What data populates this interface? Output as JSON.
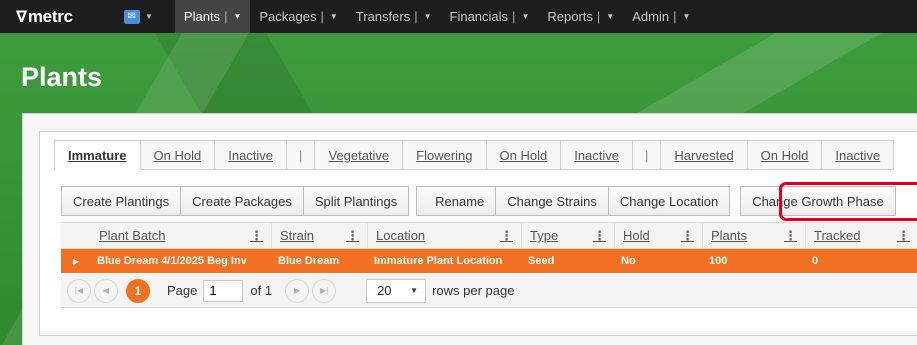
{
  "brand": {
    "logo": "∇",
    "name": "metrc"
  },
  "nav": {
    "mail_icon": "envelope-icon",
    "items": [
      {
        "label": "Plants",
        "active": true
      },
      {
        "label": "Packages",
        "active": false
      },
      {
        "label": "Transfers",
        "active": false
      },
      {
        "label": "Financials",
        "active": false
      },
      {
        "label": "Reports",
        "active": false
      },
      {
        "label": "Admin",
        "active": false
      }
    ],
    "separator": "|",
    "dropdown_glyph": "▼"
  },
  "page": {
    "title": "Plants"
  },
  "tabs": [
    {
      "label": "Immature",
      "active": true
    },
    {
      "label": "On Hold"
    },
    {
      "label": "Inactive"
    },
    {
      "label": "|"
    },
    {
      "label": "Vegetative"
    },
    {
      "label": "Flowering"
    },
    {
      "label": "On Hold"
    },
    {
      "label": "Inactive"
    },
    {
      "label": "|"
    },
    {
      "label": "Harvested"
    },
    {
      "label": "On Hold"
    },
    {
      "label": "Inactive"
    }
  ],
  "toolbar": {
    "create_plantings": "Create Plantings",
    "create_packages": "Create Packages",
    "split_plantings": "Split Plantings",
    "rename": "Rename",
    "change_strains": "Change Strains",
    "change_location": "Change Location",
    "change_growth_phase": "Change Growth Phase"
  },
  "grid": {
    "columns": [
      "Plant Batch",
      "Strain",
      "Location",
      "Type",
      "Hold",
      "Plants",
      "Tracked"
    ],
    "column_menu_glyph": "⋮",
    "rows": [
      {
        "plant_batch": "Blue Dream 4/1/2025 Beg Inv",
        "strain": "Blue Dream",
        "location": "Immature Plant Location",
        "type": "Seed",
        "hold": "No",
        "plants": "100",
        "tracked": "0"
      }
    ],
    "row_expand_glyph": "▶",
    "row_color": "#f27022"
  },
  "pager": {
    "first_glyph": "|◀",
    "prev_glyph": "◀",
    "current_page": "1",
    "next_glyph": "▶",
    "last_glyph": "▶|",
    "page_label": "Page",
    "page_value": "1",
    "of_label": "of 1",
    "rows_per_page": "20",
    "rows_per_page_label": "rows per page",
    "dropdown_glyph": "▼"
  },
  "colors": {
    "accent": "#f27022",
    "header_green": "#3a9a3a",
    "highlight_ring": "#e0001a"
  }
}
